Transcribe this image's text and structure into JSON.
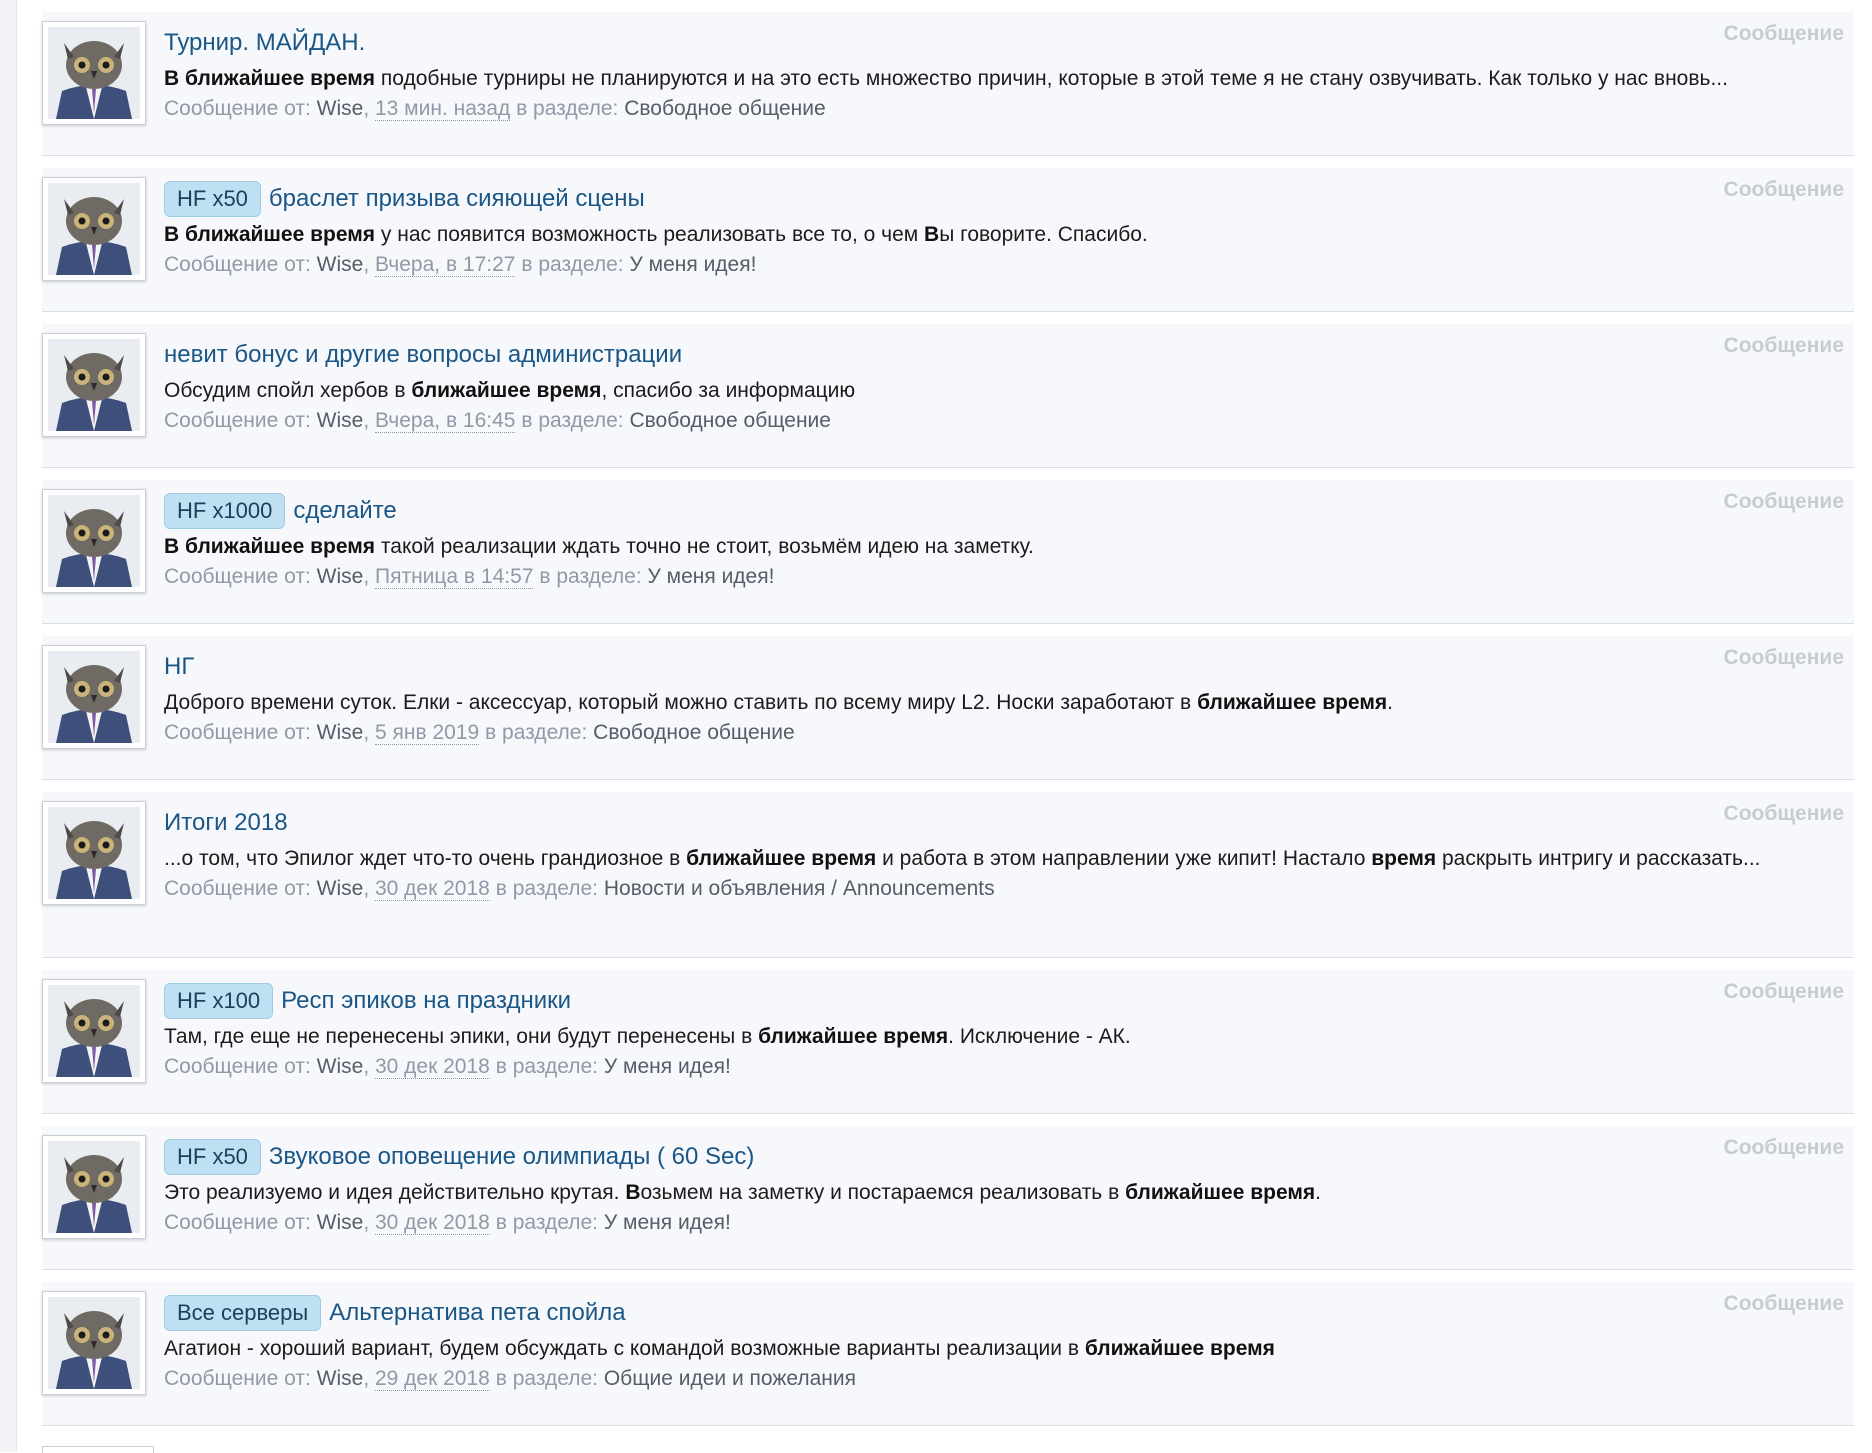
{
  "results": [
    {
      "prefix": "",
      "title": "Турнир. МАЙДАН.",
      "snippet": [
        {
          "t": "В ближайшее время",
          "b": true
        },
        {
          "t": " подобные турниры не планируются и на это есть множество причин, которые в этой теме я не стану озвучивать. Как только у нас вновь...",
          "b": false
        }
      ],
      "meta_label": "Сообщение от:",
      "user": "Wise",
      "time": "13 мин. назад",
      "section_label": "в разделе:",
      "forum": "Свободное общение",
      "type_label": "Сообщение"
    },
    {
      "prefix": "HF x50",
      "title": "браслет призыва сияющей сцены",
      "snippet": [
        {
          "t": "В ближайшее время",
          "b": true
        },
        {
          "t": " у нас появится возможность реализовать все то, о чем ",
          "b": false
        },
        {
          "t": "В",
          "b": true
        },
        {
          "t": "ы говорите. Спасибо.",
          "b": false
        }
      ],
      "meta_label": "Сообщение от:",
      "user": "Wise",
      "time": "Вчера, в 17:27",
      "section_label": "в разделе:",
      "forum": "У меня идея!",
      "type_label": "Сообщение"
    },
    {
      "prefix": "",
      "title": "невит бонус и другие вопросы администрации",
      "snippet": [
        {
          "t": "Обсудим спойл хербов в ",
          "b": false
        },
        {
          "t": "ближайшее время",
          "b": true
        },
        {
          "t": ", спасибо за информацию",
          "b": false
        }
      ],
      "meta_label": "Сообщение от:",
      "user": "Wise",
      "time": "Вчера, в 16:45",
      "section_label": "в разделе:",
      "forum": "Свободное общение",
      "type_label": "Сообщение"
    },
    {
      "prefix": "HF x1000",
      "title": "сделайте",
      "snippet": [
        {
          "t": "В ближайшее время",
          "b": true
        },
        {
          "t": " такой реализации ждать точно не стоит, возьмём идею на заметку.",
          "b": false
        }
      ],
      "meta_label": "Сообщение от:",
      "user": "Wise",
      "time": "Пятница в 14:57",
      "section_label": "в разделе:",
      "forum": "У меня идея!",
      "type_label": "Сообщение"
    },
    {
      "prefix": "",
      "title": "НГ",
      "snippet": [
        {
          "t": "Доброго времени суток. Елки - аксессуар, который можно ставить по всему миру L2. Носки заработают в ",
          "b": false
        },
        {
          "t": "ближайшее время",
          "b": true
        },
        {
          "t": ".",
          "b": false
        }
      ],
      "meta_label": "Сообщение от:",
      "user": "Wise",
      "time": "5 янв 2019",
      "section_label": "в разделе:",
      "forum": "Свободное общение",
      "type_label": "Сообщение"
    },
    {
      "prefix": "",
      "title": "Итоги 2018",
      "snippet": [
        {
          "t": "...о том, что Эпилог ждет что-то очень грандиозное в ",
          "b": false
        },
        {
          "t": "ближайшее время",
          "b": true
        },
        {
          "t": " и работа в этом направлении уже кипит! Настало ",
          "b": false
        },
        {
          "t": "время",
          "b": true
        },
        {
          "t": " раскрыть интригу и рассказать...",
          "b": false
        }
      ],
      "meta_label": "Сообщение от:",
      "user": "Wise",
      "time": "30 дек 2018",
      "section_label": "в разделе:",
      "forum": "Новости и объявления / Announcements",
      "type_label": "Сообщение"
    },
    {
      "prefix": "HF x100",
      "title": "Респ эпиков на праздники",
      "snippet": [
        {
          "t": "Там, где еще не перенесены эпики, они будут перенесены в ",
          "b": false
        },
        {
          "t": "ближайшее время",
          "b": true
        },
        {
          "t": ". Исключение - АК.",
          "b": false
        }
      ],
      "meta_label": "Сообщение от:",
      "user": "Wise",
      "time": "30 дек 2018",
      "section_label": "в разделе:",
      "forum": "У меня идея!",
      "type_label": "Сообщение"
    },
    {
      "prefix": "HF x50",
      "title": "Звуковое оповещение олимпиады ( 60 Sec)",
      "snippet": [
        {
          "t": "Это реализуемо и идея действительно крутая. ",
          "b": false
        },
        {
          "t": "В",
          "b": true
        },
        {
          "t": "озьмем на заметку и постараемся реализовать в ",
          "b": false
        },
        {
          "t": "ближайшее время",
          "b": true
        },
        {
          "t": ".",
          "b": false
        }
      ],
      "meta_label": "Сообщение от:",
      "user": "Wise",
      "time": "30 дек 2018",
      "section_label": "в разделе:",
      "forum": "У меня идея!",
      "type_label": "Сообщение"
    },
    {
      "prefix": "Все серверы",
      "title": "Альтернатива пета спойла",
      "snippet": [
        {
          "t": "Агатион - хороший вариант, будем обсуждать с командой возможные варианты реализации в ",
          "b": false
        },
        {
          "t": "ближайшее время",
          "b": true
        }
      ],
      "meta_label": "Сообщение от:",
      "user": "Wise",
      "time": "29 дек 2018",
      "section_label": "в разделе:",
      "forum": "Общие идеи и пожелания",
      "type_label": "Сообщение"
    }
  ]
}
